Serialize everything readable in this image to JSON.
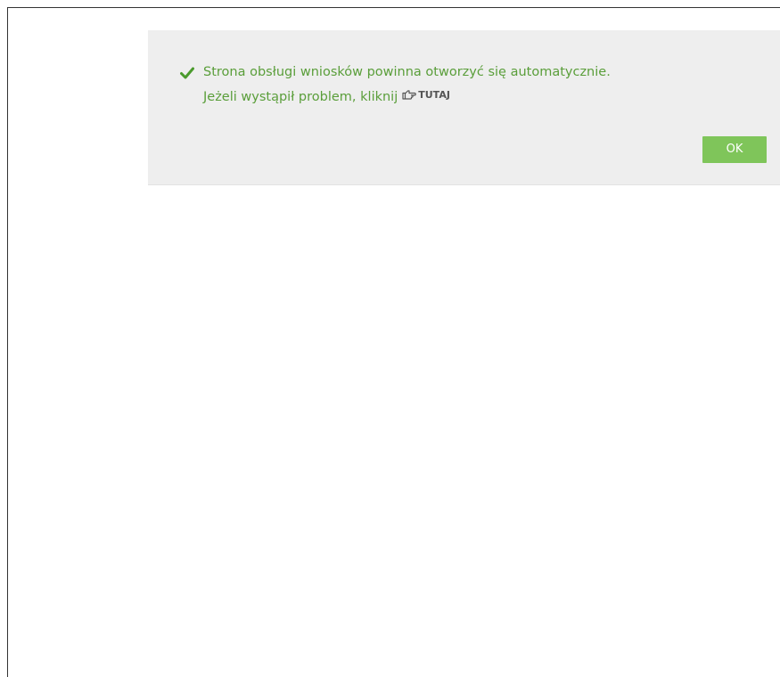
{
  "notice": {
    "line1": "Strona obsługi wniosków powinna otworzyć się automatycznie.",
    "line2": "Jeżeli wystąpił problem, kliknij",
    "link_label": "TUTAJ",
    "ok_label": "OK",
    "status_icon": "check-icon",
    "link_icon": "pointing-hand-icon"
  },
  "colors": {
    "success_text": "#5a9e3a",
    "button_bg": "#7fc55a",
    "panel_bg": "#eeeeee"
  }
}
